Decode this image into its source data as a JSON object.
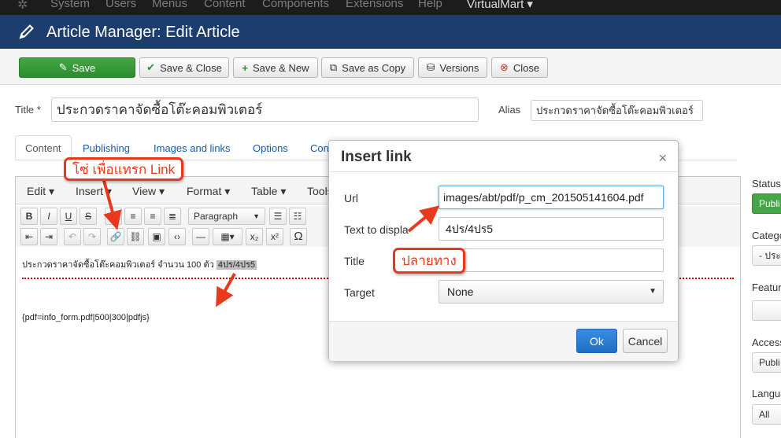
{
  "topmenu": {
    "items": [
      "System",
      "Users",
      "Menus",
      "Content",
      "Components",
      "Extensions",
      "Help",
      "VirtualMart ▾"
    ]
  },
  "header": {
    "title": "Article Manager: Edit Article"
  },
  "toolbar": {
    "save": "Save",
    "save_close": "Save & Close",
    "save_new": "Save & New",
    "save_copy": "Save as Copy",
    "versions": "Versions",
    "close": "Close"
  },
  "form": {
    "title_label": "Title *",
    "title_value": "ประกวดราคาจัดซื้อโต๊ะคอมพิวเตอร์",
    "alias_label": "Alias",
    "alias_value": "ประกวดราคาจัดซื้อโต๊ะคอมพิวเตอร์"
  },
  "tabs": [
    "Content",
    "Publishing",
    "Images and links",
    "Options",
    "Con"
  ],
  "editor": {
    "menu": [
      "Edit ▾",
      "Insert ▾",
      "View ▾",
      "Format ▾",
      "Table ▾",
      "Tools"
    ],
    "paragraph": "Paragraph",
    "content_text": "ประกวดราคาจัดซื้อโต๊ะคอมพิวเตอร์ จำนวน 100 ตัว",
    "selected_text": "4ปร/4ปร5",
    "pdf_tag": "{pdf=info_form.pdf|500|300|pdfjs}"
  },
  "sidebar": {
    "status_label": "Status",
    "status_value": "Publi",
    "category_label": "Catego",
    "category_value": "- ประ",
    "featured_label": "Featur",
    "access_label": "Access",
    "access_value": "Publi",
    "language_label": "Langua",
    "language_value": "All"
  },
  "modal": {
    "title": "Insert link",
    "close": "×",
    "url_label": "Url",
    "url_value": "images/abt/pdf/p_cm_201505141604.pdf",
    "text_label": "Text to displa",
    "text_value": "4ปร/4ปร5",
    "title_label": "Title",
    "title_value": "",
    "target_label": "Target",
    "target_value": "None",
    "ok": "Ok",
    "cancel": "Cancel"
  },
  "annotations": {
    "insert_link_note": "โซ่ เพื่อแทรก Link",
    "destination_note": "ปลายทาง"
  },
  "colors": {
    "header_bg": "#1c3d6d",
    "save_green": "#2e8c30",
    "annotation_red": "#e8391d",
    "ok_blue": "#1f6fc5"
  }
}
